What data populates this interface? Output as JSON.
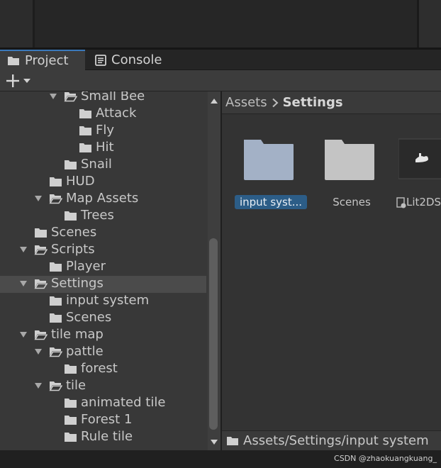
{
  "tabs": [
    {
      "label": "Project",
      "icon": "folder-icon",
      "active": true
    },
    {
      "label": "Console",
      "icon": "console-icon",
      "active": false
    }
  ],
  "toolbar": {
    "add_icon": "plus-icon",
    "dropdown_icon": "caret-down-icon"
  },
  "tree": [
    {
      "label": "Small Bee",
      "level": 3,
      "expanded": true,
      "has_children": true,
      "selected": false
    },
    {
      "label": "Attack",
      "level": 4,
      "expanded": false,
      "has_children": false,
      "selected": false
    },
    {
      "label": "Fly",
      "level": 4,
      "expanded": false,
      "has_children": false,
      "selected": false
    },
    {
      "label": "Hit",
      "level": 4,
      "expanded": false,
      "has_children": false,
      "selected": false
    },
    {
      "label": "Snail",
      "level": 3,
      "expanded": false,
      "has_children": false,
      "selected": false
    },
    {
      "label": "HUD",
      "level": 2,
      "expanded": false,
      "has_children": false,
      "selected": false
    },
    {
      "label": "Map Assets",
      "level": 2,
      "expanded": true,
      "has_children": true,
      "selected": false
    },
    {
      "label": "Trees",
      "level": 3,
      "expanded": false,
      "has_children": false,
      "selected": false
    },
    {
      "label": "Scenes",
      "level": 1,
      "expanded": false,
      "has_children": false,
      "selected": false
    },
    {
      "label": "Scripts",
      "level": 1,
      "expanded": true,
      "has_children": true,
      "selected": false
    },
    {
      "label": "Player",
      "level": 2,
      "expanded": false,
      "has_children": false,
      "selected": false
    },
    {
      "label": "Settings",
      "level": 1,
      "expanded": true,
      "has_children": true,
      "selected": true
    },
    {
      "label": "input system",
      "level": 2,
      "expanded": false,
      "has_children": false,
      "selected": false
    },
    {
      "label": "Scenes",
      "level": 2,
      "expanded": false,
      "has_children": false,
      "selected": false
    },
    {
      "label": "tile map",
      "level": 1,
      "expanded": true,
      "has_children": true,
      "selected": false
    },
    {
      "label": "pattle",
      "level": 2,
      "expanded": true,
      "has_children": true,
      "selected": false
    },
    {
      "label": "forest",
      "level": 3,
      "expanded": false,
      "has_children": false,
      "selected": false
    },
    {
      "label": "tile",
      "level": 2,
      "expanded": true,
      "has_children": true,
      "selected": false
    },
    {
      "label": "animated tile",
      "level": 3,
      "expanded": false,
      "has_children": false,
      "selected": false
    },
    {
      "label": "Forest 1",
      "level": 3,
      "expanded": false,
      "has_children": false,
      "selected": false
    },
    {
      "label": "Rule tile",
      "level": 3,
      "expanded": false,
      "has_children": false,
      "selected": false
    }
  ],
  "breadcrumb": {
    "root": "Assets",
    "current": "Settings"
  },
  "assets": [
    {
      "label": "input syst...",
      "kind": "folder",
      "selected": true
    },
    {
      "label": "Scenes",
      "kind": "folder",
      "selected": false
    },
    {
      "label": "Lit2DS",
      "kind": "render-pipeline-asset",
      "selected": false
    }
  ],
  "path_bar": {
    "path": "Assets/Settings/input system"
  },
  "watermark": "CSDN @zhaokuangkuang_",
  "colors": {
    "accent": "#3a79bb",
    "selection": "#2c5d87",
    "panel": "#383838",
    "folder_selected": "#a3b1c6",
    "folder": "#c4c4c4"
  }
}
